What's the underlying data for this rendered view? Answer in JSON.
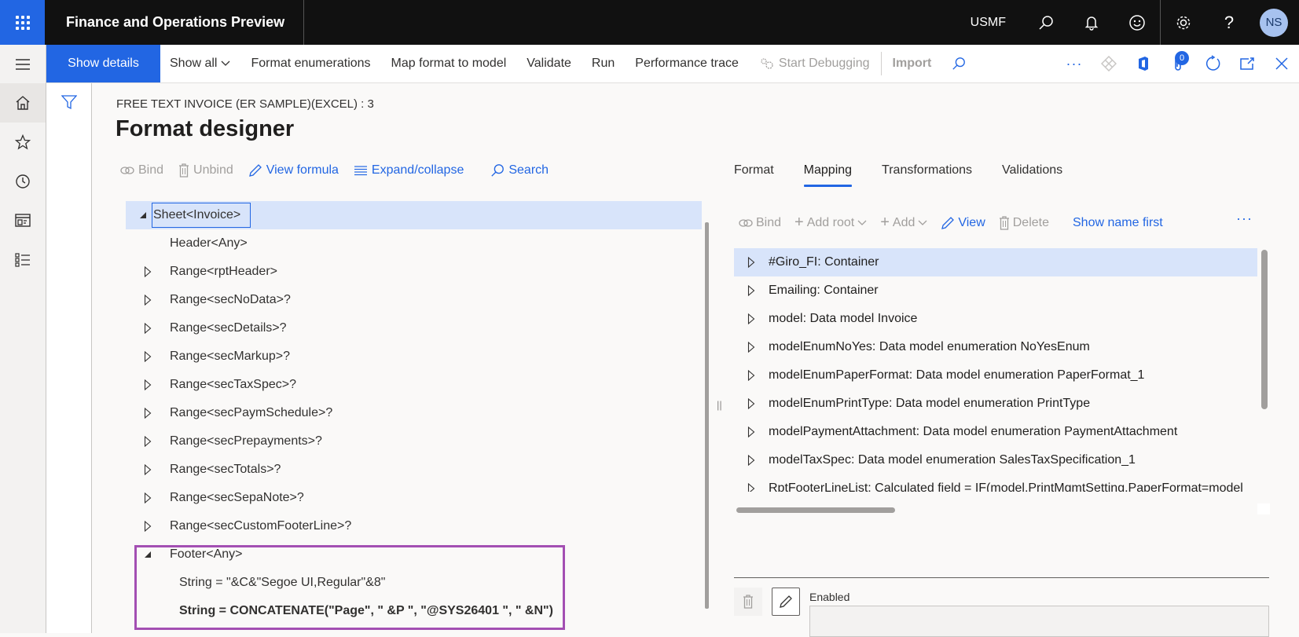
{
  "topbar": {
    "app_title": "Finance and Operations Preview",
    "company": "USMF",
    "avatar_initials": "NS",
    "icons": [
      "search-icon",
      "bell-icon",
      "smiley-icon",
      "gear-icon",
      "help-icon"
    ]
  },
  "actionbar": {
    "show_details": "Show details",
    "show_all": "Show all",
    "format_enumerations": "Format enumerations",
    "map_format_to_model": "Map format to model",
    "validate": "Validate",
    "run": "Run",
    "performance_trace": "Performance trace",
    "start_debugging": "Start Debugging",
    "import": "Import",
    "attachments_count": "0"
  },
  "page": {
    "caption": "FREE TEXT INVOICE (ER SAMPLE)(EXCEL) : 3",
    "title": "Format designer"
  },
  "left_toolbar": {
    "bind": "Bind",
    "unbind": "Unbind",
    "view_formula": "View formula",
    "expand_collapse": "Expand/collapse",
    "search": "Search"
  },
  "format_tree": [
    {
      "label": "Sheet<Invoice>",
      "level": 0,
      "expander": "expanded",
      "selected": true
    },
    {
      "label": "Header<Any>",
      "level": 1,
      "expander": "none"
    },
    {
      "label": "Range<rptHeader>",
      "level": 1,
      "expander": "collapsed"
    },
    {
      "label": "Range<secNoData>?",
      "level": 1,
      "expander": "collapsed"
    },
    {
      "label": "Range<secDetails>?",
      "level": 1,
      "expander": "collapsed"
    },
    {
      "label": "Range<secMarkup>?",
      "level": 1,
      "expander": "collapsed"
    },
    {
      "label": "Range<secTaxSpec>?",
      "level": 1,
      "expander": "collapsed"
    },
    {
      "label": "Range<secPaymSchedule>?",
      "level": 1,
      "expander": "collapsed"
    },
    {
      "label": "Range<secPrepayments>?",
      "level": 1,
      "expander": "collapsed"
    },
    {
      "label": "Range<secTotals>?",
      "level": 1,
      "expander": "collapsed"
    },
    {
      "label": "Range<secSepaNote>?",
      "level": 1,
      "expander": "collapsed"
    },
    {
      "label": "Range<secCustomFooterLine>?",
      "level": 1,
      "expander": "collapsed"
    },
    {
      "label": "Footer<Any>",
      "level": 1,
      "expander": "expanded"
    },
    {
      "label": "String = \"&C&\"Segoe UI,Regular\"&8\"",
      "level": 2,
      "expander": "none"
    },
    {
      "label": "String = CONCATENATE(\"Page\", \" &P \", \"@SYS26401 \", \" &N\")",
      "level": 2,
      "expander": "none",
      "bold": true
    }
  ],
  "tabs": [
    {
      "label": "Format",
      "active": false
    },
    {
      "label": "Mapping",
      "active": true
    },
    {
      "label": "Transformations",
      "active": false
    },
    {
      "label": "Validations",
      "active": false
    }
  ],
  "right_toolbar": {
    "bind": "Bind",
    "add_root": "Add root",
    "add": "Add",
    "view": "View",
    "delete": "Delete",
    "show_name_first": "Show name first"
  },
  "mapping_tree": [
    {
      "label": "#Giro_FI: Container",
      "selected": true
    },
    {
      "label": "Emailing: Container"
    },
    {
      "label": "model: Data model Invoice"
    },
    {
      "label": "modelEnumNoYes: Data model enumeration NoYesEnum"
    },
    {
      "label": "modelEnumPaperFormat: Data model enumeration PaperFormat_1"
    },
    {
      "label": "modelEnumPrintType: Data model enumeration PrintType"
    },
    {
      "label": "modelPaymentAttachment: Data model enumeration PaymentAttachment"
    },
    {
      "label": "modelTaxSpec: Data model enumeration SalesTaxSpecification_1"
    },
    {
      "label": "RptFooterLineList: Calculated field = IF(model.PrintMgmtSetting.PaperFormat=model"
    }
  ],
  "details": {
    "enabled_label": "Enabled",
    "enabled_value": ""
  },
  "colors": {
    "accent": "#2266e3",
    "selection": "#d8e4fa",
    "highlight_box": "#a34fb3",
    "topbar": "#111111"
  }
}
